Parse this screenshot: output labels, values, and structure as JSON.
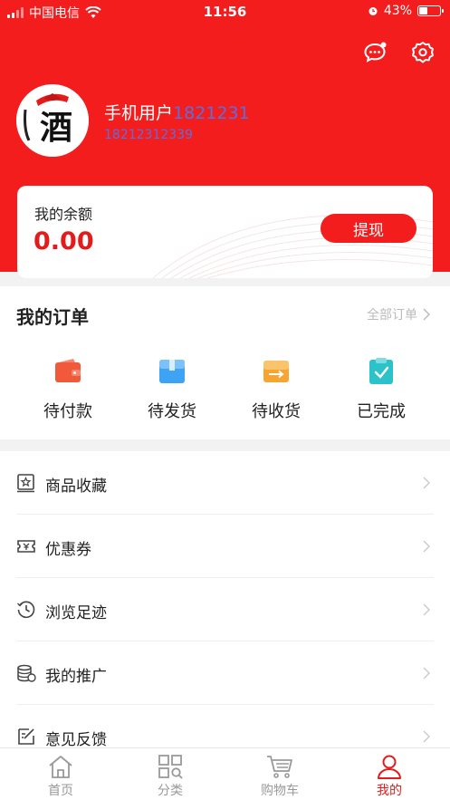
{
  "status_bar": {
    "carrier": "中国电信",
    "time": "11:56",
    "battery": "43%",
    "battery_level": 0.43
  },
  "header": {
    "icons": [
      "message-icon",
      "settings-icon"
    ]
  },
  "profile": {
    "name": "手机用户",
    "uid": "1821231",
    "phone": "18212312339",
    "avatar_text": "酒"
  },
  "balance": {
    "label": "我的余额",
    "value": "0.00",
    "withdraw_label": "提现"
  },
  "orders": {
    "title": "我的订单",
    "all_label": "全部订单",
    "items": [
      {
        "label": "待付款",
        "icon": "wallet-icon",
        "color": "#f05a3b"
      },
      {
        "label": "待发货",
        "icon": "box-icon",
        "color": "#3ea3f5"
      },
      {
        "label": "待收货",
        "icon": "delivery-icon",
        "color": "#f7a531"
      },
      {
        "label": "已完成",
        "icon": "check-clipboard-icon",
        "color": "#2bc3c9"
      }
    ]
  },
  "menu": {
    "items": [
      {
        "label": "商品收藏",
        "icon": "favorite-icon"
      },
      {
        "label": "优惠券",
        "icon": "coupon-icon"
      },
      {
        "label": "浏览足迹",
        "icon": "history-icon"
      },
      {
        "label": "我的推广",
        "icon": "promotion-icon"
      },
      {
        "label": "意见反馈",
        "icon": "feedback-icon"
      }
    ]
  },
  "tabbar": {
    "items": [
      {
        "label": "首页",
        "icon": "home-icon",
        "active": false
      },
      {
        "label": "分类",
        "icon": "category-icon",
        "active": false
      },
      {
        "label": "购物车",
        "icon": "cart-icon",
        "active": false
      },
      {
        "label": "我的",
        "icon": "user-icon",
        "active": true
      }
    ]
  },
  "colors": {
    "brand_red": "#f41d1d",
    "value_red": "#e41b1b",
    "id_blue": "#5b6ee0"
  }
}
